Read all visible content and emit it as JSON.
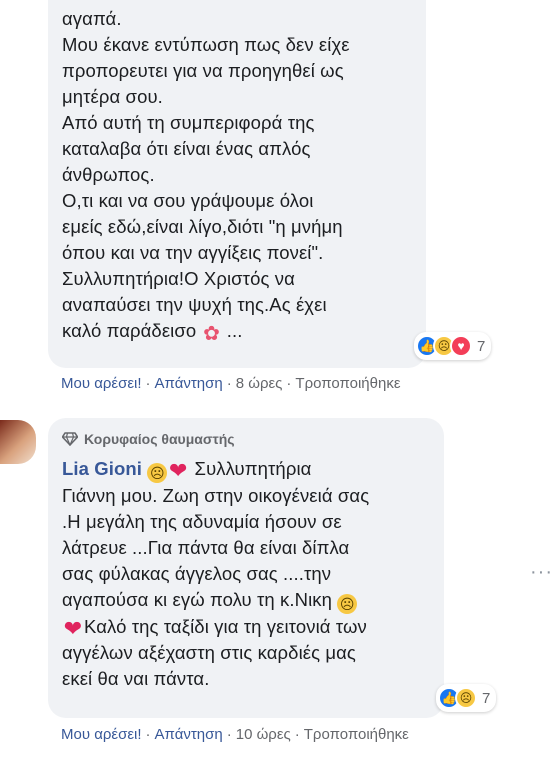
{
  "comment1": {
    "lines": [
      "αγαπά.",
      "Μου έκανε εντύπωση πως δεν είχε",
      "προπορευτει για να προηγηθεί ως",
      "μητέρα σου.",
      "Από αυτή τη συμπεριφορά της",
      "καταλαβα ότι είναι ένας απλός",
      "άνθρωπος.",
      "Ο,τι και να σου γράψουμε όλοι",
      "εμείς εδώ,είναι λίγο,διότι \"η μνήμη",
      "όπου και να την αγγίξεις πονεί\".",
      "Συλλυπητήρια!Ο Χριστός να",
      "αναπαύσει την ψυχή της.Ας έχει",
      "καλό παράδεισο"
    ],
    "ellipsis": "...",
    "reaction_count": "7",
    "actions": {
      "like": "Μου αρέσει!",
      "reply": "Απάντηση",
      "time": "8 ώρες",
      "edited": "Τροποποιήθηκε"
    }
  },
  "comment2": {
    "badge": "Κορυφαίος θαυμαστής",
    "author": "Lia Gioni",
    "first_line_text": "Συλλυπητήρια",
    "lines": [
      "Γιάννη μου. Ζωη στην οικογένειά σας",
      ".Η μεγάλη της αδυναμία ήσουν σε",
      "λάτρευε ...Για πάντα θα είναι δίπλα",
      "σας φύλακας άγγελος σας ....την",
      "αγαπούσα κι εγώ πολυ τη κ.Νικη"
    ],
    "line7_text": "Καλό της ταξίδι για τη γειτονιά των",
    "tail_lines": [
      "αγγέλων αξέχαστη στις καρδιές μας",
      "εκεί θα ναι πάντα."
    ],
    "reaction_count": "7",
    "actions": {
      "like": "Μου αρέσει!",
      "reply": "Απάντηση",
      "time": "10 ώρες",
      "edited": "Τροποποιήθηκε"
    }
  },
  "separator": "·",
  "more_dots": "···"
}
